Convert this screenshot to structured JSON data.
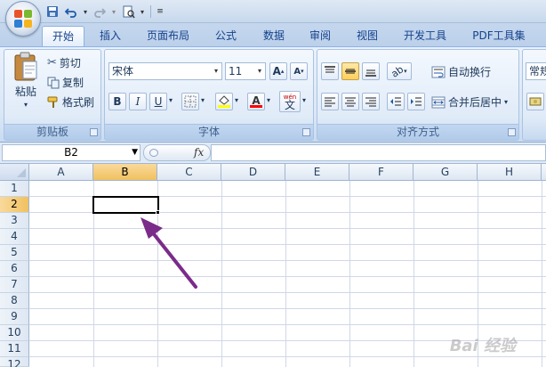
{
  "ribbon_tabs": [
    "开始",
    "插入",
    "页面布局",
    "公式",
    "数据",
    "审阅",
    "视图",
    "开发工具",
    "PDF工具集"
  ],
  "active_tab": "开始",
  "clipboard": {
    "paste_label": "粘贴",
    "cut_label": "剪切",
    "copy_label": "复制",
    "format_painter_label": "格式刷",
    "group_label": "剪贴板"
  },
  "font": {
    "font_name": "宋体",
    "font_size": "11",
    "bold": "B",
    "italic": "I",
    "underline": "U",
    "grow": "A",
    "shrink": "A",
    "font_color_glyph": "A",
    "phonetic_glyph": "文",
    "phonetic_small": "wén",
    "group_label": "字体"
  },
  "alignment": {
    "wrap_text_label": "自动换行",
    "merge_center_label": "合并后居中",
    "group_label": "对齐方式"
  },
  "number": {
    "format_partial": "常规"
  },
  "formula_bar": {
    "name_box": "B2",
    "fx": "fx",
    "formula": ""
  },
  "sheet": {
    "columns": [
      "A",
      "B",
      "C",
      "D",
      "E",
      "F",
      "G",
      "H"
    ],
    "rows": [
      "1",
      "2",
      "3",
      "4",
      "5",
      "6",
      "7",
      "8",
      "9",
      "10",
      "11",
      "12"
    ],
    "selected_column": "B",
    "selected_row": "2",
    "selected_cell": "B2"
  },
  "watermark": "Bai 经验",
  "colors": {
    "arrow": "#7b2b8a",
    "selection_header": "#f1c15f",
    "ribbon_bg": "#dbe7f6",
    "tab_text": "#15428b"
  }
}
